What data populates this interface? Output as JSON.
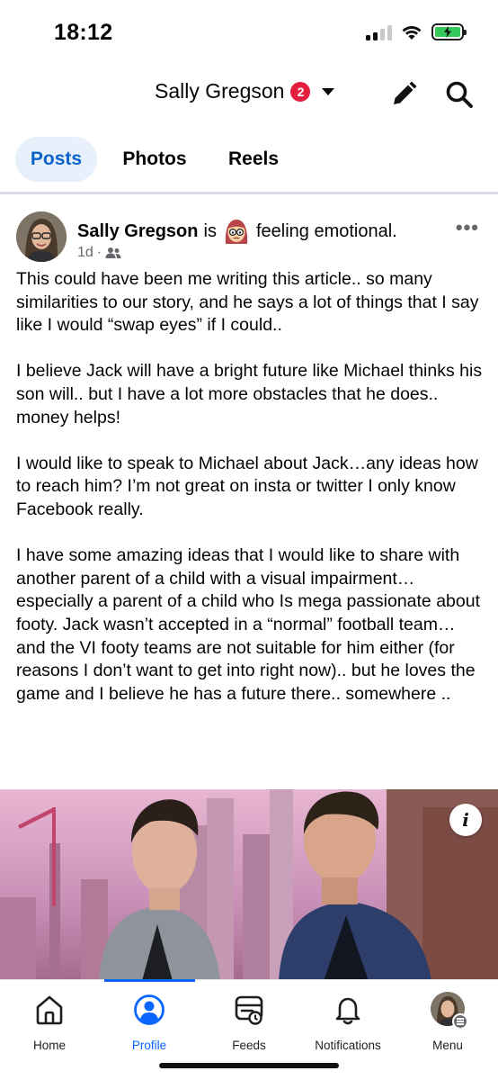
{
  "status_bar": {
    "time": "18:12"
  },
  "header": {
    "profile_name": "Sally Gregson",
    "notification_badge": "2",
    "edit_icon": "pencil-icon",
    "search_icon": "search-icon"
  },
  "tabs": [
    {
      "label": "Posts",
      "active": true
    },
    {
      "label": "Photos",
      "active": false
    },
    {
      "label": "Reels",
      "active": false
    }
  ],
  "post": {
    "author": "Sally Gregson",
    "is_text": "is",
    "feeling": "feeling emotional.",
    "time_ago": "1d",
    "separator": "·",
    "audience_icon": "friends-icon",
    "paragraphs": [
      "This could have been me writing this article.. so many similarities to our story, and he says a lot of things that I say like I would “swap eyes” if I could..",
      "I believe Jack will have a bright future like Michael thinks his son will.. but I have a lot more obstacles that he does.. money helps!",
      "I would like to speak to Michael about Jack…any ideas how to reach him? I’m not great on insta or twitter I only know Facebook really.",
      "I have some amazing ideas that I would like to share with another parent of a child with a visual impairment… especially a parent of a child who Is mega passionate about footy. Jack wasn’t accepted in a “normal” football team… and the VI footy teams are not suitable for him either (for reasons I don’t want to get into right now).. but he loves the game and I believe he has a future there.. somewhere .."
    ],
    "info_button": "i"
  },
  "bottom_nav": [
    {
      "label": "Home",
      "icon": "home-icon",
      "active": false
    },
    {
      "label": "Profile",
      "icon": "profile-icon",
      "active": true
    },
    {
      "label": "Feeds",
      "icon": "feeds-icon",
      "active": false
    },
    {
      "label": "Notifications",
      "icon": "bell-icon",
      "active": false
    },
    {
      "label": "Menu",
      "icon": "menu-avatar-icon",
      "active": false
    }
  ],
  "colors": {
    "accent": "#0866ff",
    "active_tab_bg": "#e7f0fb",
    "active_tab_text": "#0b63c9",
    "badge": "#e41e3f",
    "battery": "#34c759"
  }
}
